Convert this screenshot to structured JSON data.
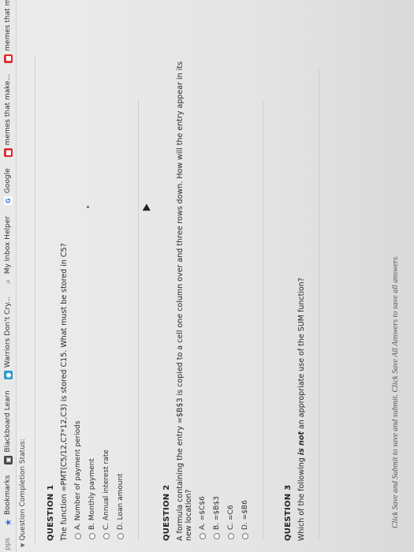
{
  "browser": {
    "bookmarks": [
      {
        "label": "Bookmarks",
        "icon": "bookmark-star-icon"
      },
      {
        "label": "Blackboard Learn",
        "icon": "blackboard-icon"
      },
      {
        "label": "Warriors Don't Cry...",
        "icon": "site-favicon-icon"
      },
      {
        "label": "My Inbox Helper",
        "icon": "search-icon"
      },
      {
        "label": "Google",
        "icon": "google-icon"
      },
      {
        "label": "memes that make...",
        "icon": "red-favicon-icon"
      },
      {
        "label": "memes that mak...",
        "icon": "red-favicon-icon"
      }
    ],
    "apps_label": "pps"
  },
  "completion": {
    "label": "Question Completion Status:"
  },
  "questions": [
    {
      "title": "QUESTION 1",
      "text": "The function =PMT(C5/12,C7*12,C3) is stored C15. What must be stored in C5?",
      "choices": [
        "A. Number of payment periods",
        "B. Monthly payment",
        "C. Annual interest rate",
        "D. Loan amount"
      ]
    },
    {
      "title": "QUESTION 2",
      "text": "A formula containing the entry =$B$3 is copied to a cell one column over and three rows down. How will the entry appear in its new location?",
      "choices": [
        "A. =$C$6",
        "B. =$B$3",
        "C. =C6",
        "D. =$B6"
      ]
    },
    {
      "title": "QUESTION 3",
      "text_before": "Which of the following ",
      "text_bold": "is not",
      "text_after": " an appropriate use of the SUM function?"
    }
  ],
  "footer": {
    "text": "Click Save and Submit to save and submit. Click Save All Answers to save all answers."
  }
}
